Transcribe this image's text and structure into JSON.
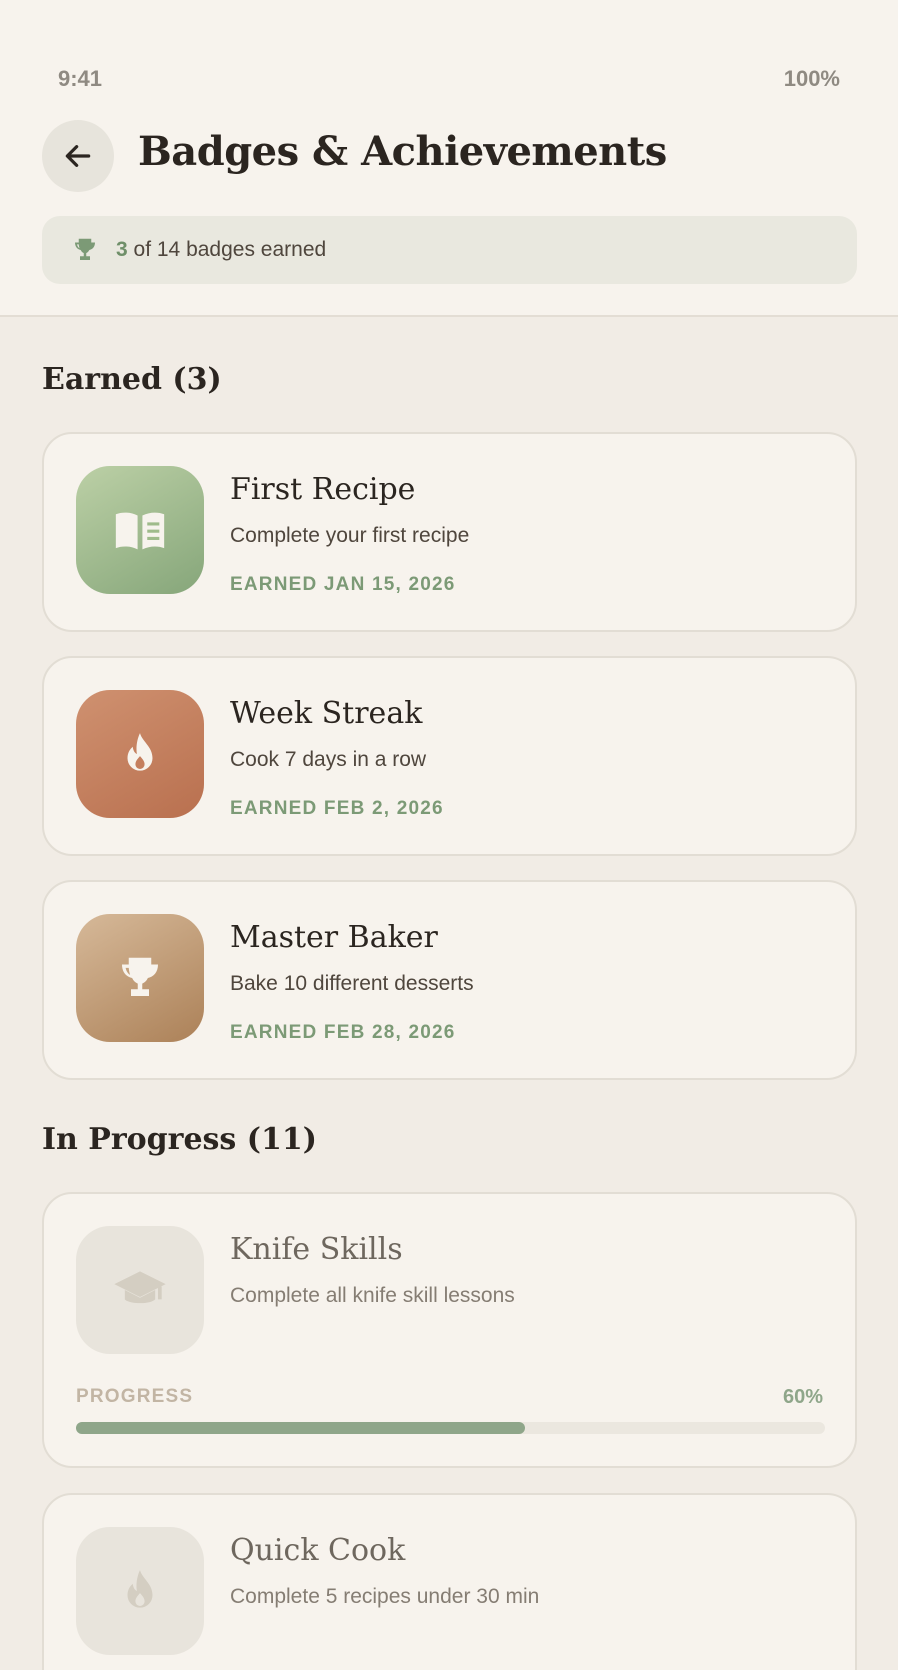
{
  "status_bar": {
    "time": "9:41",
    "battery": "100%"
  },
  "header": {
    "title": "Badges & Achievements",
    "summary": {
      "earned": "3",
      "text": "of 14 badges earned"
    }
  },
  "earned_section": {
    "title": "Earned (3)",
    "badges": [
      {
        "name": "First Recipe",
        "description": "Complete your first recipe",
        "date": "EARNED JAN 15, 2026",
        "icon": "book-icon",
        "color": "#9fbb8b"
      },
      {
        "name": "Week Streak",
        "description": "Cook 7 days in a row",
        "date": "EARNED FEB 2, 2026",
        "icon": "flame-icon",
        "color": "#c57f5e"
      },
      {
        "name": "Master Baker",
        "description": "Bake 10 different desserts",
        "date": "EARNED FEB 28, 2026",
        "icon": "trophy-icon",
        "color": "#c09a73"
      }
    ]
  },
  "progress_section": {
    "title": "In Progress (11)",
    "badges": [
      {
        "name": "Knife Skills",
        "description": "Complete all knife skill lessons",
        "icon": "graduation-cap-icon",
        "progress_label": "PROGRESS",
        "progress_text": "60%",
        "progress": 0.6
      },
      {
        "name": "Quick Cook",
        "description": "Complete 5 recipes under 30 min",
        "icon": "flame-icon"
      }
    ]
  },
  "colors": {
    "accent_green": "#7c9a76",
    "background": "#f1ece5",
    "card": "#f7f3ed"
  }
}
